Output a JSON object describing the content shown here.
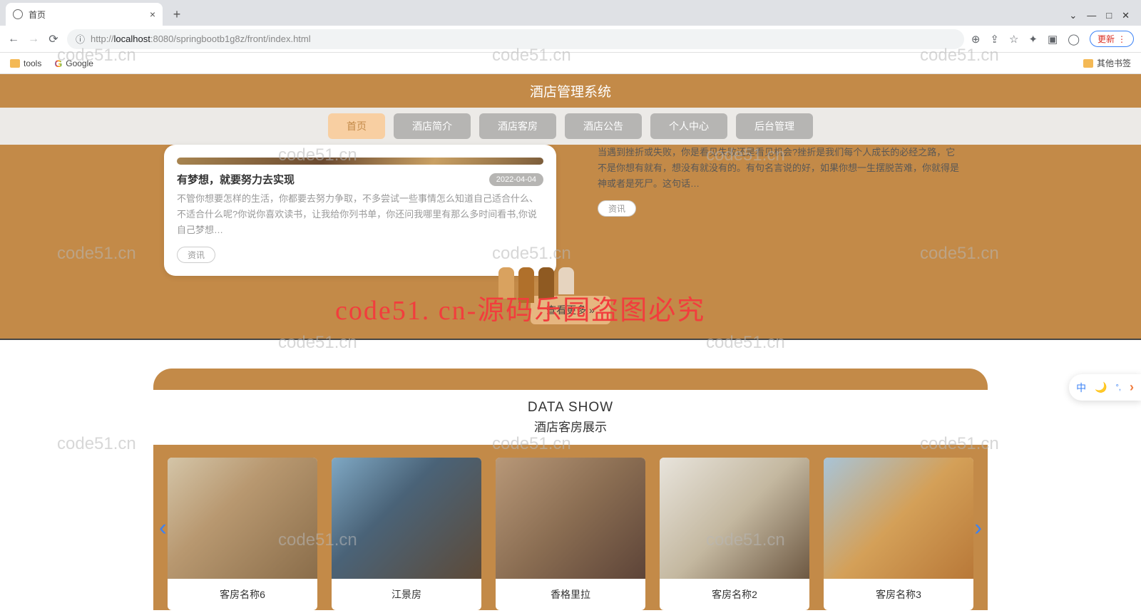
{
  "browser": {
    "tab_title": "首页",
    "url_host": "localhost",
    "url_port": ":8080",
    "url_path": "/springbootb1g8z/front/index.html",
    "url_prefix": "http://",
    "update_label": "更新",
    "bookmarks": {
      "tools": "tools",
      "google": "Google",
      "other": "其他书签"
    }
  },
  "site": {
    "title": "酒店管理系统",
    "nav": [
      "首页",
      "酒店简介",
      "酒店客房",
      "酒店公告",
      "个人中心",
      "后台管理"
    ],
    "active_nav_index": 0
  },
  "news": {
    "card1": {
      "title": "有梦想，就要努力去实现",
      "date": "2022-04-04",
      "desc": "不管你想要怎样的生活，你都要去努力争取，不多尝试一些事情怎么知道自己适合什么、不适合什么呢?你说你喜欢读书，让我给你列书单，你还问我哪里有那么多时间看书,你说自己梦想…",
      "tag": "资讯"
    },
    "card2": {
      "desc": "当遇到挫折或失败，你是看见失败还是看见机会?挫折是我们每个人成长的必经之路，它不是你想有就有，想没有就没有的。有句名言说的好，如果你想一生摆脱苦难，你就得是神或者是死尸。这句话…",
      "tag": "资讯"
    },
    "more": "查看更多 »"
  },
  "datashow": {
    "title_en": "DATA SHOW",
    "title_cn": "酒店客房展示",
    "rooms": [
      "客房名称6",
      "江景房",
      "香格里拉",
      "客房名称2",
      "客房名称3"
    ]
  },
  "watermarks": {
    "text": "code51.cn",
    "red": "code51. cn-源码乐园盗图必究"
  },
  "side": {
    "lang": "中"
  }
}
